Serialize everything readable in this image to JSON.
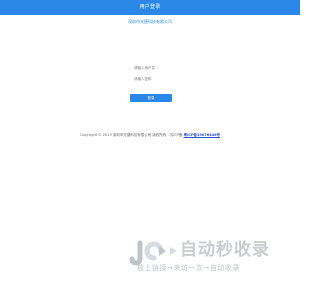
{
  "header": {
    "title": "用户登录"
  },
  "company": {
    "link_text": "深圳市光捷科技有限公司"
  },
  "form": {
    "username_placeholder": "请输入用户名",
    "password_placeholder": "请输入密码",
    "submit_label": "登录"
  },
  "footer": {
    "copyright": "Copyright © 2019 深圳市光捷科技有限公司 版权所有 - 苏ICP备",
    "icp": "粤ICP备19076446号"
  },
  "watermark": {
    "title": "自动秒收录",
    "subtitle": "放上链接→来访一次→自动收录",
    "colors": {
      "dark": "#c0c4c9",
      "light": "#d8dbdf"
    }
  },
  "colors": {
    "accent": "#2b88e8",
    "text": "#666666",
    "icp": "#2b4fd6"
  }
}
